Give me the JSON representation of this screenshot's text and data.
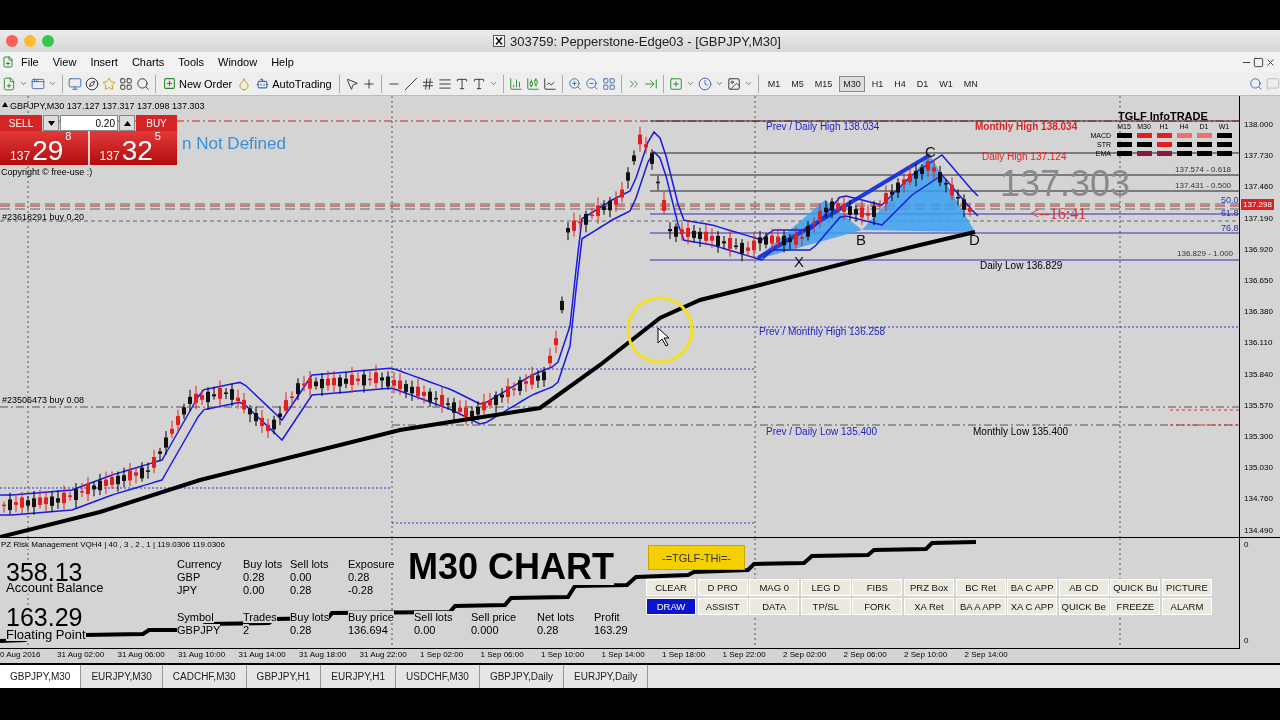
{
  "window": {
    "title": "303759: Pepperstone-Edge03 - [GBPJPY,M30]"
  },
  "menu": [
    "File",
    "View",
    "Insert",
    "Charts",
    "Tools",
    "Window",
    "Help"
  ],
  "toolbar": {
    "new_order": "New Order",
    "autotrading": "AutoTrading",
    "timeframes": [
      {
        "label": "M1",
        "selected": false
      },
      {
        "label": "M5",
        "selected": false
      },
      {
        "label": "M15",
        "selected": false
      },
      {
        "label": "M30",
        "selected": true
      },
      {
        "label": "H1",
        "selected": false
      },
      {
        "label": "H4",
        "selected": false
      },
      {
        "label": "D1",
        "selected": false
      },
      {
        "label": "W1",
        "selected": false
      },
      {
        "label": "MN",
        "selected": false
      }
    ]
  },
  "chart": {
    "header": "GBPJPY,M30  137.127 137.317 137.098 137.303",
    "trade_panel": {
      "sell": "SELL",
      "buy": "BUY",
      "lots": "0.20",
      "sell_price": {
        "big": "137",
        "main": "29",
        "sup": "8"
      },
      "buy_price": {
        "big": "137",
        "main": "32",
        "sup": "5"
      }
    },
    "annotations": [
      {
        "kind": "plain",
        "text": "Copyright © free-use :)"
      },
      {
        "kind": "order",
        "text": "#23618291 buy 0.20"
      },
      {
        "kind": "order",
        "text": "#23506473 buy 0.08"
      },
      {
        "kind": "status",
        "text": "n Not Defined"
      },
      {
        "kind": "blue",
        "text": "Prev / Daily High 138.034"
      },
      {
        "kind": "redbold",
        "text": "Monthly High 138.034"
      },
      {
        "kind": "red",
        "text": "Daily High 137.124"
      },
      {
        "kind": "big",
        "text": "137.303"
      },
      {
        "kind": "small",
        "text": "137.574 - 0.618"
      },
      {
        "kind": "small",
        "text": "137.431 - 0.500"
      },
      {
        "kind": "fib",
        "text": "50.0"
      },
      {
        "kind": "fib",
        "text": "61.8"
      },
      {
        "kind": "fib",
        "text": "76.8"
      },
      {
        "kind": "timer",
        "text": "<--16:41"
      },
      {
        "kind": "pattern",
        "text": "C"
      },
      {
        "kind": "pattern",
        "text": "X"
      },
      {
        "kind": "pattern",
        "text": "B"
      },
      {
        "kind": "pattern",
        "text": "D"
      },
      {
        "kind": "small",
        "text": "136.829 - 1.000"
      },
      {
        "kind": "black",
        "text": "Daily Low 136.829"
      },
      {
        "kind": "blue",
        "text": "Prev / Monthly High 136.258"
      },
      {
        "kind": "blue",
        "text": "Prev / Daily Low 135.400"
      },
      {
        "kind": "black",
        "text": "Monthly Low 135.400"
      }
    ],
    "info_panel": {
      "title": "TGLF InfoTRADE",
      "columns": [
        "M15",
        "M30",
        "H1",
        "H4",
        "D1",
        "W1"
      ],
      "rows": [
        {
          "name": "MACD",
          "signals": [
            {
              "color": "#000000"
            },
            {
              "color": "#e02020"
            },
            {
              "color": "#e02020"
            },
            {
              "color": "#f07070"
            },
            {
              "color": "#f07070"
            },
            {
              "color": "#000000"
            }
          ]
        },
        {
          "name": "STR",
          "signals": [
            {
              "color": "#000000"
            },
            {
              "color": "#000000"
            },
            {
              "color": "#e02020"
            },
            {
              "color": "#000000"
            },
            {
              "color": "#000000"
            },
            {
              "color": "#000000"
            }
          ]
        },
        {
          "name": "EMA",
          "signals": [
            {
              "color": "#000000"
            },
            {
              "color": "#8b1a3a"
            },
            {
              "color": "#8b1a3a"
            },
            {
              "color": "#000000"
            },
            {
              "color": "#000000"
            },
            {
              "color": "#000000"
            }
          ]
        }
      ]
    },
    "price_axis": [
      "138.000",
      "137.730",
      "137.460",
      "137.190",
      "136.920",
      "136.650",
      "136.380",
      "136.110",
      "135.840",
      "135.570",
      "135.300",
      "135.030",
      "134.760",
      "134.490"
    ],
    "current_price": "137.298"
  },
  "risk_panel": {
    "header": "PZ Risk Management  VQH4 |  40 , 3 , 2 , 1  |  119.0306 119.0306",
    "balance": "358.13",
    "balance_label": "Account Balance",
    "floating": "163.29",
    "floating_label": "Floating Point",
    "exposure_table": {
      "columns": [
        "Currency",
        "Buy lots",
        "Sell lots",
        "Exposure"
      ],
      "rows": [
        [
          "GBP",
          "0.28",
          "0.00",
          "0.28"
        ],
        [
          "JPY",
          "0.00",
          "0.28",
          "-0.28"
        ]
      ]
    },
    "symbol_table": {
      "columns": [
        "Symbol",
        "Trades",
        "Buy lots",
        "Buy price",
        "Sell lots",
        "Sell price",
        "Net lots",
        "Profit"
      ],
      "rows": [
        [
          "GBPJPY",
          "2",
          "0.28",
          "136.694",
          "0.00",
          "0.000",
          "0.28",
          "163.29"
        ]
      ]
    },
    "chart_label": "M30 CHART",
    "tglf_button": "-=TGLF-THi=-",
    "tool_buttons": [
      [
        {
          "label": "CLEAR",
          "selected": false
        },
        {
          "label": "D PRO",
          "selected": false
        },
        {
          "label": "MAG 0",
          "selected": false
        },
        {
          "label": "LEG D",
          "selected": false
        },
        {
          "label": "FIBS",
          "selected": false
        },
        {
          "label": "PRZ Box",
          "selected": false
        },
        {
          "label": "BC Ret",
          "selected": false
        },
        {
          "label": "BA C APP",
          "selected": false
        },
        {
          "label": "AB CD",
          "selected": false
        },
        {
          "label": "QUICK Bu",
          "selected": false
        },
        {
          "label": "PICTURE",
          "selected": false
        }
      ],
      [
        {
          "label": "DRAW",
          "selected": true
        },
        {
          "label": "ASSIST",
          "selected": false
        },
        {
          "label": "DATA",
          "selected": false
        },
        {
          "label": "TP/SL",
          "selected": false
        },
        {
          "label": "FORK",
          "selected": false
        },
        {
          "label": "XA Ret",
          "selected": false
        },
        {
          "label": "BA A APP",
          "selected": false
        },
        {
          "label": "XA C APP",
          "selected": false
        },
        {
          "label": "QUICK Be",
          "selected": false
        },
        {
          "label": "FREEZE",
          "selected": false
        },
        {
          "label": "ALARM",
          "selected": false
        }
      ]
    ],
    "scale": [
      "0",
      "0"
    ]
  },
  "time_axis": [
    "0 Aug 2016",
    "31 Aug 02:00",
    "31 Aug 06:00",
    "31 Aug 10:00",
    "31 Aug 14:00",
    "31 Aug 18:00",
    "31 Aug 22:00",
    "1 Sep 02:00",
    "1 Sep 06:00",
    "1 Sep 10:00",
    "1 Sep 14:00",
    "1 Sep 18:00",
    "1 Sep 22:00",
    "2 Sep 02:00",
    "2 Sep 06:00",
    "2 Sep 10:00",
    "2 Sep 14:00"
  ],
  "tabs": [
    {
      "label": "GBPJPY,M30",
      "selected": true
    },
    {
      "label": "EURJPY,M30",
      "selected": false
    },
    {
      "label": "CADCHF,M30",
      "selected": false
    },
    {
      "label": "GBPJPY,H1",
      "selected": false
    },
    {
      "label": "EURJPY,H1",
      "selected": false
    },
    {
      "label": "USDCHF,M30",
      "selected": false
    },
    {
      "label": "GBPJPY,Daily",
      "selected": false
    },
    {
      "label": "EURJPY,Daily",
      "selected": false
    }
  ]
}
